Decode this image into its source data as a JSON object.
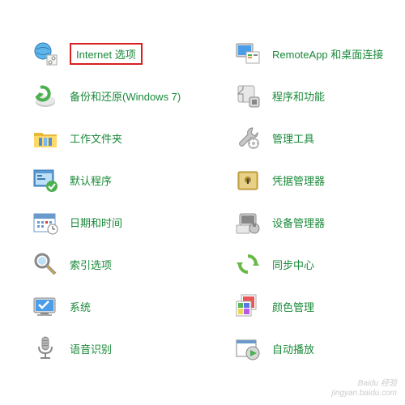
{
  "col1": [
    {
      "label": "Internet 选项",
      "icon": "internet-options-icon",
      "highlighted": true
    },
    {
      "label": "备份和还原(Windows 7)",
      "icon": "backup-restore-icon"
    },
    {
      "label": "工作文件夹",
      "icon": "work-folders-icon"
    },
    {
      "label": "默认程序",
      "icon": "default-programs-icon"
    },
    {
      "label": "日期和时间",
      "icon": "date-time-icon"
    },
    {
      "label": "索引选项",
      "icon": "indexing-options-icon"
    },
    {
      "label": "系统",
      "icon": "system-icon"
    },
    {
      "label": "语音识别",
      "icon": "speech-recognition-icon"
    }
  ],
  "col2": [
    {
      "label": "RemoteApp 和桌面连接",
      "icon": "remoteapp-icon"
    },
    {
      "label": "程序和功能",
      "icon": "programs-features-icon"
    },
    {
      "label": "管理工具",
      "icon": "admin-tools-icon"
    },
    {
      "label": "凭据管理器",
      "icon": "credential-manager-icon"
    },
    {
      "label": "设备管理器",
      "icon": "device-manager-icon"
    },
    {
      "label": "同步中心",
      "icon": "sync-center-icon"
    },
    {
      "label": "颜色管理",
      "icon": "color-management-icon"
    },
    {
      "label": "自动播放",
      "icon": "autoplay-icon"
    }
  ],
  "watermark": {
    "line1": "Baidu 经验",
    "line2": "jingyan.baidu.com"
  }
}
